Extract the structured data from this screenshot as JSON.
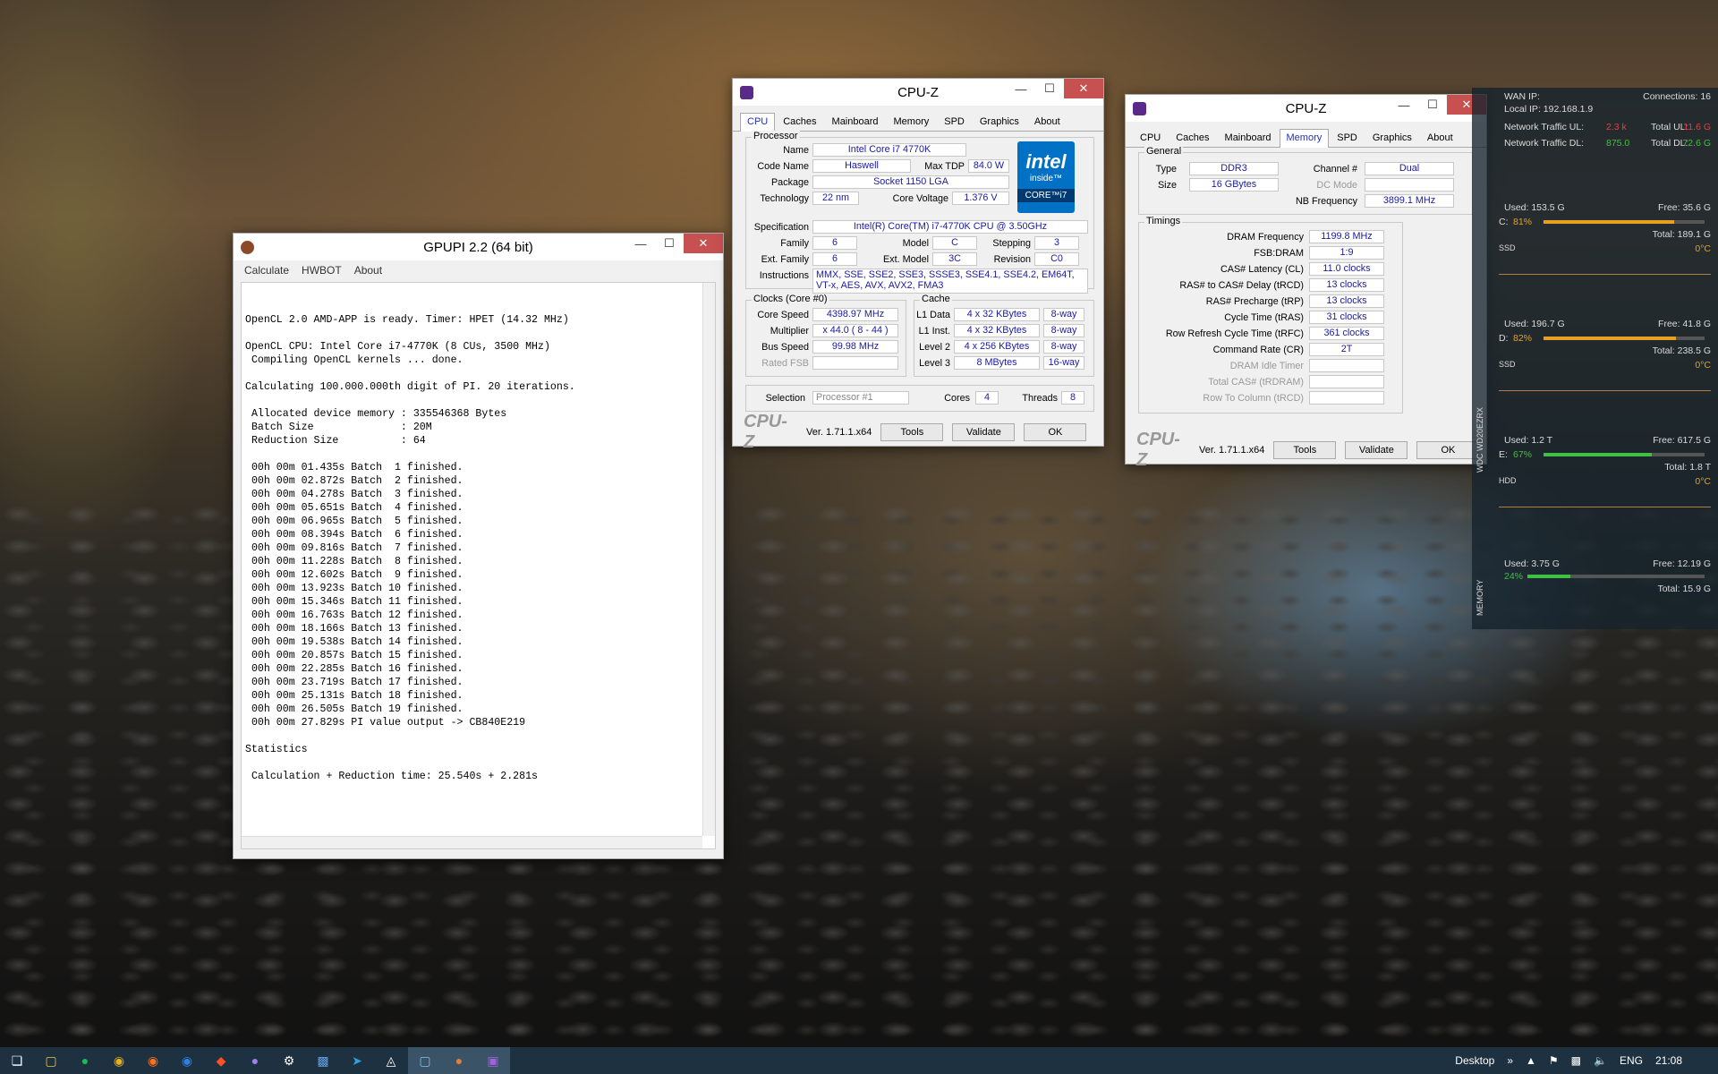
{
  "gpupi": {
    "title": "GPUPI 2.2 (64 bit)",
    "menu": [
      "Calculate",
      "HWBOT",
      "About"
    ],
    "console": "OpenCL 2.0 AMD-APP is ready. Timer: HPET (14.32 MHz)\n\nOpenCL CPU: Intel Core i7-4770K (8 CUs, 3500 MHz)\n Compiling OpenCL kernels ... done.\n\nCalculating 100.000.000th digit of PI. 20 iterations.\n\n Allocated device memory : 335546368 Bytes\n Batch Size              : 20M\n Reduction Size          : 64\n\n 00h 00m 01.435s Batch  1 finished.\n 00h 00m 02.872s Batch  2 finished.\n 00h 00m 04.278s Batch  3 finished.\n 00h 00m 05.651s Batch  4 finished.\n 00h 00m 06.965s Batch  5 finished.\n 00h 00m 08.394s Batch  6 finished.\n 00h 00m 09.816s Batch  7 finished.\n 00h 00m 11.228s Batch  8 finished.\n 00h 00m 12.602s Batch  9 finished.\n 00h 00m 13.923s Batch 10 finished.\n 00h 00m 15.346s Batch 11 finished.\n 00h 00m 16.763s Batch 12 finished.\n 00h 00m 18.166s Batch 13 finished.\n 00h 00m 19.538s Batch 14 finished.\n 00h 00m 20.857s Batch 15 finished.\n 00h 00m 22.285s Batch 16 finished.\n 00h 00m 23.719s Batch 17 finished.\n 00h 00m 25.131s Batch 18 finished.\n 00h 00m 26.505s Batch 19 finished.\n 00h 00m 27.829s PI value output -> CB840E219\n\nStatistics\n\n Calculation + Reduction time: 25.540s + 2.281s"
  },
  "cpuz_tabs": [
    "CPU",
    "Caches",
    "Mainboard",
    "Memory",
    "SPD",
    "Graphics",
    "About"
  ],
  "cpuz_title": "CPU-Z",
  "cpuz_brand": "CPU-Z",
  "cpuz_version": "Ver. 1.71.1.x64",
  "cpuz_buttons": {
    "tools": "Tools",
    "validate": "Validate",
    "ok": "OK"
  },
  "cpu": {
    "processor_label": "Processor",
    "name_l": "Name",
    "name": "Intel Core i7 4770K",
    "code_l": "Code Name",
    "code": "Haswell",
    "tdp_l": "Max TDP",
    "tdp": "84.0 W",
    "package_l": "Package",
    "package": "Socket 1150 LGA",
    "tech_l": "Technology",
    "tech": "22 nm",
    "volt_l": "Core Voltage",
    "volt": "1.376 V",
    "spec_l": "Specification",
    "spec": "Intel(R) Core(TM) i7-4770K CPU @ 3.50GHz",
    "family_l": "Family",
    "family": "6",
    "model_l": "Model",
    "model": "C",
    "stepping_l": "Stepping",
    "stepping": "3",
    "extfam_l": "Ext. Family",
    "extfam": "6",
    "extmod_l": "Ext. Model",
    "extmod": "3C",
    "rev_l": "Revision",
    "rev": "C0",
    "instr_l": "Instructions",
    "instr": "MMX, SSE, SSE2, SSE3, SSSE3, SSE4.1, SSE4.2, EM64T,\nVT-x, AES, AVX, AVX2, FMA3",
    "clocks_label": "Clocks (Core #0)",
    "speed_l": "Core Speed",
    "speed": "4398.97 MHz",
    "mult_l": "Multiplier",
    "mult": "x 44.0 ( 8 - 44 )",
    "bus_l": "Bus Speed",
    "bus": "99.98 MHz",
    "fsb_l": "Rated FSB",
    "fsb": "",
    "cache_label": "Cache",
    "l1d_l": "L1 Data",
    "l1d": "4 x 32 KBytes",
    "l1d_w": "8-way",
    "l1i_l": "L1 Inst.",
    "l1i": "4 x 32 KBytes",
    "l1i_w": "8-way",
    "l2_l": "Level 2",
    "l2": "4 x 256 KBytes",
    "l2_w": "8-way",
    "l3_l": "Level 3",
    "l3": "8 MBytes",
    "l3_w": "16-way",
    "sel_l": "Selection",
    "sel": "Processor #1",
    "cores_l": "Cores",
    "cores": "4",
    "threads_l": "Threads",
    "threads": "8",
    "intel_logo": "intel",
    "intel_inside": "inside™",
    "intel_core": "CORE™i7"
  },
  "mem": {
    "general_label": "General",
    "type_l": "Type",
    "type": "DDR3",
    "size_l": "Size",
    "size": "16 GBytes",
    "chan_l": "Channel #",
    "chan": "Dual",
    "dc_l": "DC Mode",
    "dc": "",
    "nb_l": "NB Frequency",
    "nb": "3899.1 MHz",
    "timings_label": "Timings",
    "t": [
      {
        "l": "DRAM Frequency",
        "v": "1199.8 MHz"
      },
      {
        "l": "FSB:DRAM",
        "v": "1:9"
      },
      {
        "l": "CAS# Latency (CL)",
        "v": "11.0 clocks"
      },
      {
        "l": "RAS# to CAS# Delay (tRCD)",
        "v": "13 clocks"
      },
      {
        "l": "RAS# Precharge (tRP)",
        "v": "13 clocks"
      },
      {
        "l": "Cycle Time (tRAS)",
        "v": "31 clocks"
      },
      {
        "l": "Row Refresh Cycle Time (tRFC)",
        "v": "361 clocks"
      },
      {
        "l": "Command Rate (CR)",
        "v": "2T"
      },
      {
        "l": "DRAM Idle Timer",
        "v": ""
      },
      {
        "l": "Total CAS# (tRDRAM)",
        "v": ""
      },
      {
        "l": "Row To Column (tRCD)",
        "v": ""
      }
    ]
  },
  "rainmeter": {
    "wan": "WAN IP:",
    "conn": "Connections: 16",
    "local": "Local IP: 192.168.1.9",
    "ul_l": "Network Traffic UL:",
    "ul": "2.3 k",
    "tul_l": "Total UL:",
    "tul": "11.6 G",
    "dl_l": "Network Traffic DL:",
    "dl": "875.0",
    "tdl_l": "Total DL:",
    "tdl": "72.6 G",
    "drives": [
      {
        "used": "Used: 153.5 G",
        "free": "Free: 35.6 G",
        "letter": "C:",
        "pct": "81%",
        "pct_val": 0.81,
        "total": "Total: 189.1 G",
        "type": "SSD",
        "temp": "0°C",
        "color": "#e8a020"
      },
      {
        "used": "Used: 196.7 G",
        "free": "Free: 41.8 G",
        "letter": "D:",
        "pct": "82%",
        "pct_val": 0.82,
        "total": "Total: 238.5 G",
        "type": "SSD",
        "temp": "0°C",
        "color": "#e8a020"
      },
      {
        "used": "Used: 1.2 T",
        "free": "Free: 617.5 G",
        "letter": "E:",
        "pct": "67%",
        "pct_val": 0.67,
        "total": "Total: 1.8 T",
        "type": "HDD",
        "temp": "0°C",
        "color": "#40c040"
      }
    ],
    "mem_used": "Used: 3.75 G",
    "mem_free": "Free: 12.19 G",
    "mem_pct": "24%",
    "mem_pct_val": 0.24,
    "mem_total": "Total: 15.9 G",
    "side_label_1": "WDC WD20EZRX",
    "side_label_2": "MEMORY"
  },
  "taskbar": {
    "desktop": "Desktop",
    "lang": "ENG",
    "time": "21:08",
    "chevrons": "»"
  }
}
